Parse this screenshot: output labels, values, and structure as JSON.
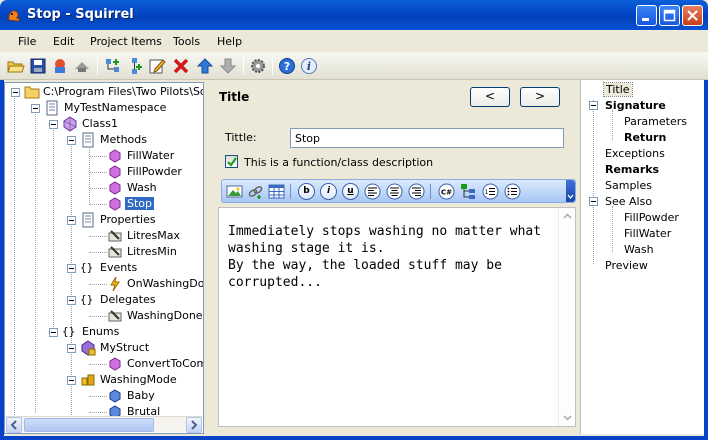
{
  "window": {
    "title": "Stop - Squirrel"
  },
  "menu": [
    "File",
    "Edit",
    "Project Items",
    "Tools",
    "Help"
  ],
  "tree": {
    "root": "C:\\Program Files\\Two Pilots\\Squ",
    "namespace": "MyTestNamespace",
    "class1": "Class1",
    "methods": "Methods",
    "fillwater": "FillWater",
    "fillpowder": "FillPowder",
    "wash": "Wash",
    "stop": "Stop",
    "properties": "Properties",
    "litresmax": "LitresMax",
    "litresmin": "LitresMin",
    "events": "Events",
    "onwashingdone": "OnWashingDone",
    "delegates": "Delegates",
    "washingdonede": "WashingDoneDe",
    "enums": "Enums",
    "mystruct": "MyStruct",
    "converttocomp": "ConvertToComp",
    "washingmode": "WashingMode",
    "baby": "Baby",
    "brutal": "Brutal"
  },
  "editor": {
    "section_title": "Title",
    "prev_label": "<",
    "next_label": ">",
    "title_label": "Tittle:",
    "title_value": "Stop",
    "checkbox_label": "This is a function/class description",
    "checkbox_checked": true,
    "body_text": "Immediately stops washing no matter what washing stage it is.\nBy the way, the loaded stuff may be corrupted..."
  },
  "outline": {
    "title": "Title",
    "signature": "Signature",
    "parameters": "Parameters",
    "return": "Return",
    "exceptions": "Exceptions",
    "remarks": "Remarks",
    "samples": "Samples",
    "see_also": "See Also",
    "fillpowder": "FillPowder",
    "fillwater": "FillWater",
    "wash": "Wash",
    "preview": "Preview"
  },
  "colors": {
    "titlebar": "#0348c9",
    "selection": "#316ac5",
    "panel": "#ece9d8"
  },
  "icons": [
    "app-squirrel-icon",
    "minimize-icon",
    "maximize-icon",
    "close-icon",
    "folder-icon",
    "namespace-icon",
    "class-icon",
    "method-icon",
    "property-icon",
    "event-icon",
    "enum-icon",
    "struct-icon"
  ]
}
